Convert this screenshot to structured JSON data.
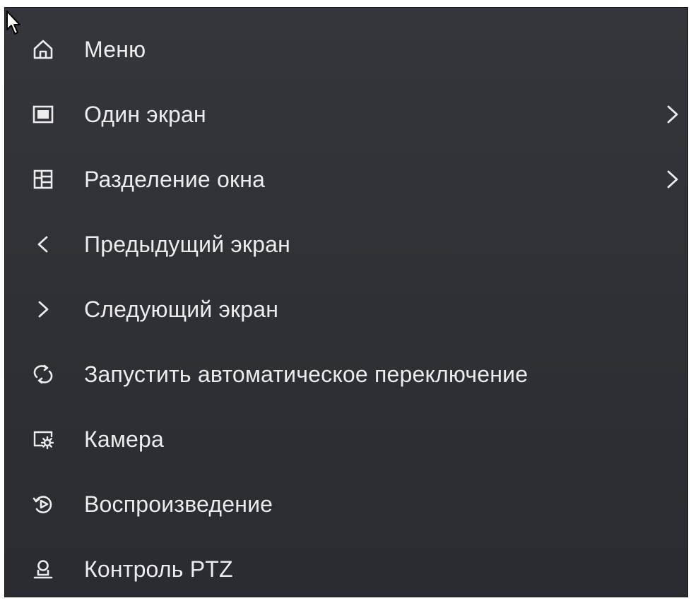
{
  "menu": {
    "items": [
      {
        "label": "Меню",
        "icon": "home-icon",
        "submenu": false
      },
      {
        "label": "Один экран",
        "icon": "single-screen-icon",
        "submenu": true
      },
      {
        "label": "Разделение окна",
        "icon": "split-window-icon",
        "submenu": true
      },
      {
        "label": "Предыдущий экран",
        "icon": "chevron-left-icon",
        "submenu": false
      },
      {
        "label": "Следующий экран",
        "icon": "chevron-right-icon",
        "submenu": false
      },
      {
        "label": "Запустить автоматическое переключение",
        "icon": "auto-switch-icon",
        "submenu": false
      },
      {
        "label": "Камера",
        "icon": "camera-settings-icon",
        "submenu": false
      },
      {
        "label": "Воспроизведение",
        "icon": "playback-icon",
        "submenu": false
      },
      {
        "label": "Контроль PTZ",
        "icon": "ptz-control-icon",
        "submenu": false
      }
    ]
  },
  "colors": {
    "background": "#2e3035",
    "text": "#ececee",
    "border": "#18191c"
  },
  "cursor": {
    "icon": "mouse-pointer-icon"
  }
}
